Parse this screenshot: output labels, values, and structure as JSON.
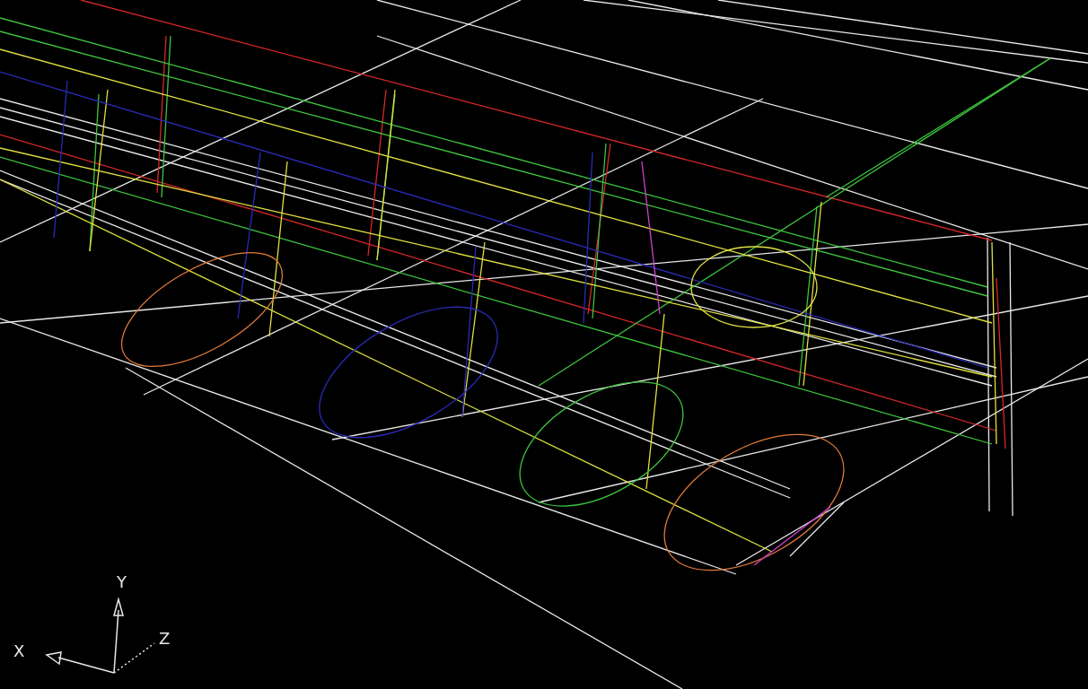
{
  "viewport": {
    "axis_icon": {
      "x_label": "X",
      "y_label": "Y",
      "z_label": "Z"
    }
  }
}
